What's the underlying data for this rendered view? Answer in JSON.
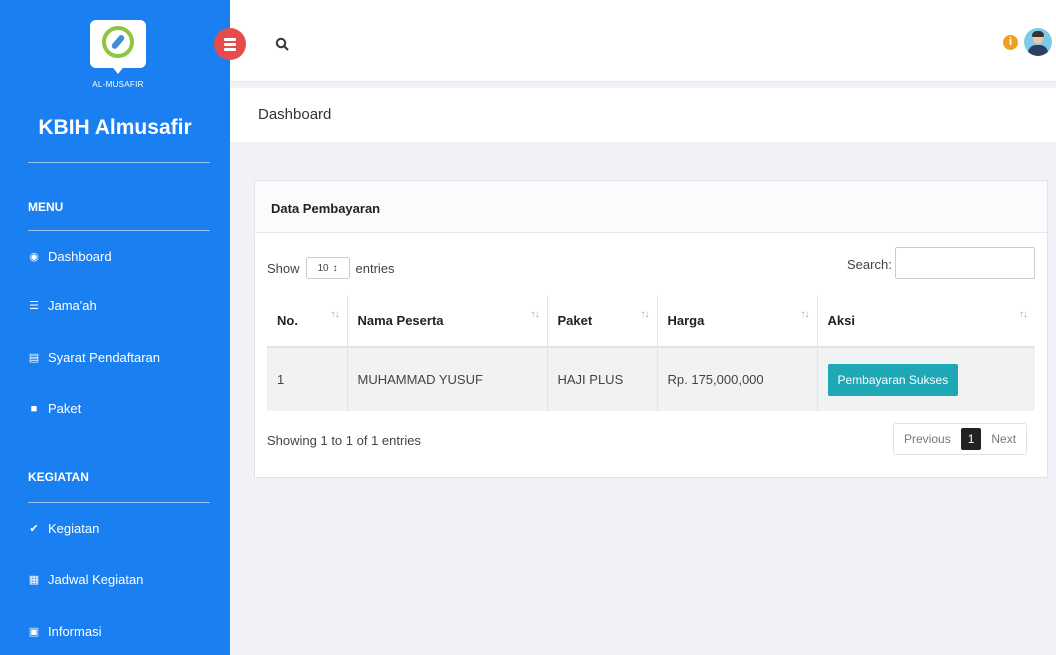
{
  "sidebar": {
    "logo_text": "AL-MUSAFIR",
    "brand": "KBIH Almusafir",
    "sections": {
      "menu": "MENU",
      "kegiatan": "KEGIATAN"
    },
    "menu_items": [
      {
        "label": "Dashboard",
        "icon": "dashboard-icon"
      },
      {
        "label": "Jama'ah",
        "icon": "list-icon"
      },
      {
        "label": "Syarat Pendaftaran",
        "icon": "list-alt-icon"
      },
      {
        "label": "Paket",
        "icon": "folder-icon"
      }
    ],
    "kegiatan_items": [
      {
        "label": "Kegiatan",
        "icon": "check-icon"
      },
      {
        "label": "Jadwal Kegiatan",
        "icon": "calendar-icon"
      },
      {
        "label": "Informasi",
        "icon": "image-icon"
      }
    ],
    "color": "#1a7ff0"
  },
  "header": {
    "title": "Dashboard"
  },
  "card": {
    "title": "Data Pembayaran",
    "length": {
      "show": "Show",
      "value": "10",
      "entries": "entries"
    },
    "search_label": "Search:",
    "columns": [
      "No.",
      "Nama Peserta",
      "Paket",
      "Harga",
      "Aksi"
    ],
    "rows": [
      {
        "no": "1",
        "nama": "MUHAMMAD YUSUF",
        "paket": "HAJI PLUS",
        "harga": "Rp. 175,000,000",
        "aksi": "Pembayaran Sukses"
      }
    ],
    "info": "Showing 1 to 1 of 1 entries",
    "pagination": {
      "previous": "Previous",
      "page": "1",
      "next": "Next"
    },
    "button_color": "#1ea8b6"
  }
}
